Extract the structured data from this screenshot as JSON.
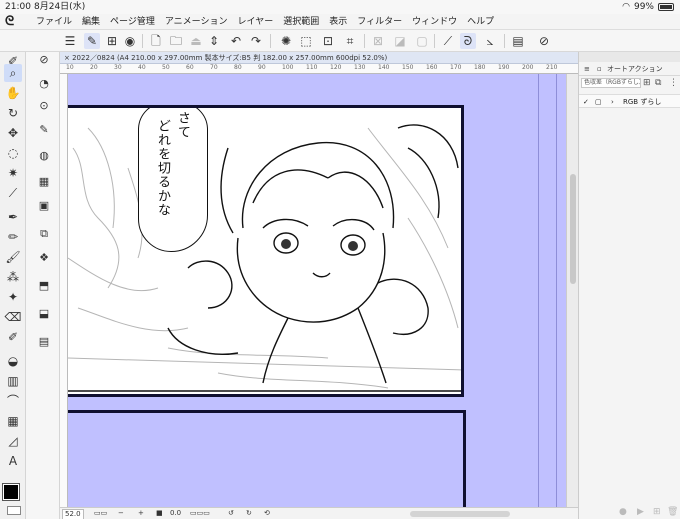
{
  "status_bar": {
    "time": "21:00",
    "date": "8月24日(水)",
    "battery": "99%"
  },
  "menu": {
    "items": [
      "ファイル",
      "編集",
      "ページ管理",
      "アニメーション",
      "レイヤー",
      "選択範囲",
      "表示",
      "フィルター",
      "ウィンドウ",
      "ヘルプ"
    ]
  },
  "document": {
    "tab_title": "× 2022／0824 (A4 210.00 x 297.00mm 製本サイズ:B5 判 182.00 x 257.00mm 600dpi 52.0%)",
    "ruler_ticks": [
      "10",
      "20",
      "30",
      "40",
      "50",
      "60",
      "70",
      "80",
      "90",
      "100",
      "110",
      "120",
      "130",
      "140",
      "150",
      "160",
      "170",
      "180",
      "190",
      "200",
      "210"
    ],
    "speech_line1": "さて",
    "speech_line2": "どれを切るかな"
  },
  "bottom_bar": {
    "zoom": "52.0",
    "angle": "0.0"
  },
  "right_panel": {
    "title": "オートアクション",
    "set_select": "色収差（RGBずらし）ア",
    "action_name": "RGB ずらし"
  },
  "colors": {
    "page_blue": "#c0c0ff",
    "panel_border": "#101030",
    "active_tool": "#cfdcf8",
    "canvas_bg": "#c4c4c4"
  }
}
